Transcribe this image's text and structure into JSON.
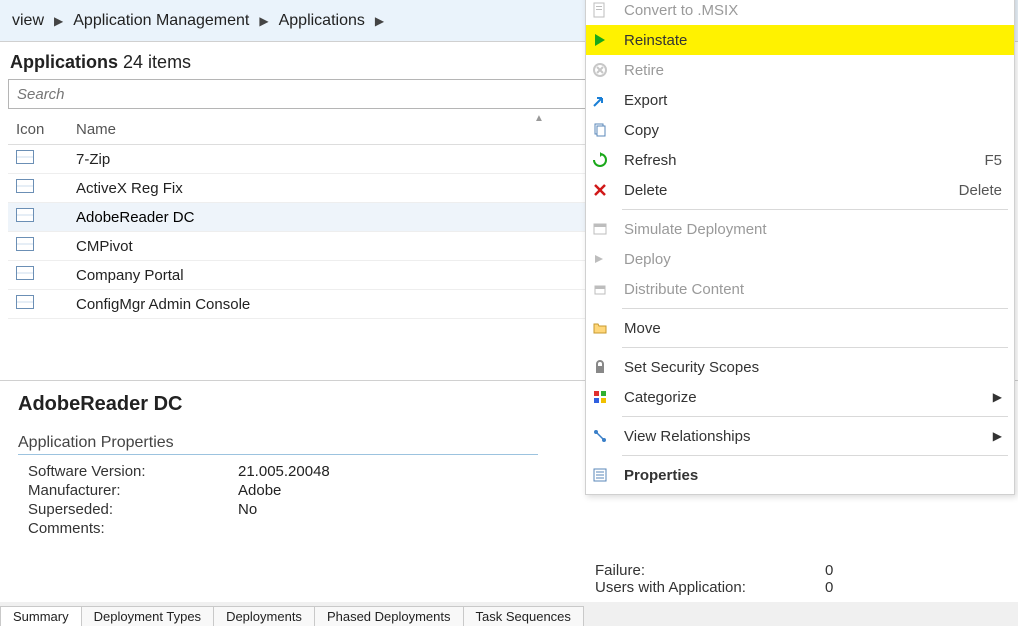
{
  "breadcrumb": [
    "view",
    "Application Management",
    "Applications"
  ],
  "content_header": {
    "title": "Applications",
    "count": "24 items"
  },
  "search": {
    "placeholder": "Search"
  },
  "table": {
    "columns": [
      "Icon",
      "Name"
    ],
    "rows": [
      {
        "name": "7-Zip"
      },
      {
        "name": "ActiveX Reg Fix"
      },
      {
        "name": "AdobeReader DC",
        "selected": true
      },
      {
        "name": "CMPivot"
      },
      {
        "name": "Company Portal"
      },
      {
        "name": "ConfigMgr Admin Console"
      }
    ]
  },
  "detail": {
    "title": "AdobeReader DC",
    "section": "Application Properties",
    "props": {
      "software_version_k": "Software Version:",
      "software_version_v": "21.005.20048",
      "manufacturer_k": "Manufacturer:",
      "manufacturer_v": "Adobe",
      "superseded_k": "Superseded:",
      "superseded_v": "No",
      "comments_k": "Comments:"
    },
    "right": {
      "failure_k": "Failure:",
      "failure_v": "0",
      "users_k": "Users with Application:",
      "users_v": "0"
    }
  },
  "tabs": [
    "Summary",
    "Deployment Types",
    "Deployments",
    "Phased Deployments",
    "Task Sequences"
  ],
  "menu": {
    "items": [
      {
        "label": "Convert to .MSIX",
        "icon": "page-icon",
        "disabled": true
      },
      {
        "label": "Reinstate",
        "icon": "play-icon",
        "highlight": true
      },
      {
        "label": "Retire",
        "icon": "close-gray-icon",
        "disabled": true
      },
      {
        "label": "Export",
        "icon": "arrow-out-icon"
      },
      {
        "label": "Copy",
        "icon": "copy-icon"
      },
      {
        "label": "Refresh",
        "icon": "refresh-icon",
        "shortcut": "F5"
      },
      {
        "label": "Delete",
        "icon": "delete-icon",
        "shortcut": "Delete"
      },
      {
        "sep": true
      },
      {
        "label": "Simulate Deployment",
        "icon": "window-icon",
        "disabled": true
      },
      {
        "label": "Deploy",
        "icon": "arrow-right-icon",
        "disabled": true
      },
      {
        "label": "Distribute Content",
        "icon": "package-icon",
        "disabled": true
      },
      {
        "sep": true
      },
      {
        "label": "Move",
        "icon": "folder-icon"
      },
      {
        "sep": true
      },
      {
        "label": "Set Security Scopes",
        "icon": "lock-icon"
      },
      {
        "label": "Categorize",
        "icon": "categorize-icon",
        "submenu": true
      },
      {
        "sep": true
      },
      {
        "label": "View Relationships",
        "icon": "relation-icon",
        "submenu": true
      },
      {
        "sep": true
      },
      {
        "label": "Properties",
        "icon": "properties-icon",
        "bold": true
      }
    ]
  }
}
